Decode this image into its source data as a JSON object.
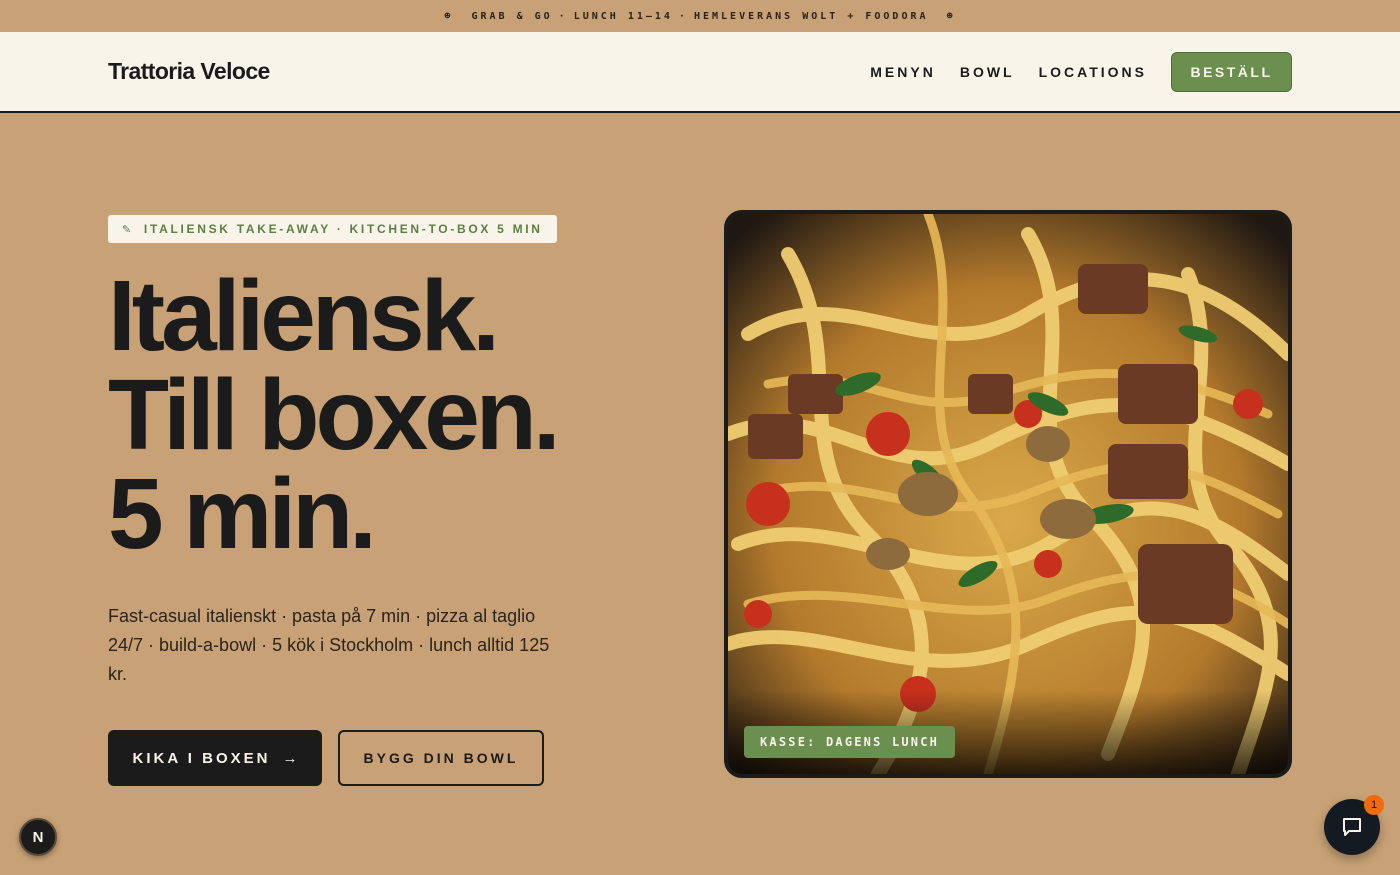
{
  "topbar": {
    "icon": "smiley-icon",
    "parts": [
      "GRAB & GO",
      "LUNCH 11–14",
      "HEMLEVERANS WOLT + FOODORA"
    ],
    "separator": "·"
  },
  "nav": {
    "brand": "Trattoria Veloce",
    "links": [
      "MENYN",
      "BOWL",
      "LOCATIONS"
    ],
    "order_label": "BESTÄLL"
  },
  "hero": {
    "tag": "ITALIENSK TAKE-AWAY · KITCHEN-TO-BOX 5 MIN",
    "tag_icon": "pin-icon",
    "headline": [
      "Italiensk.",
      "Till boxen.",
      "5 min."
    ],
    "subtitle": "Fast-casual italienskt · pasta på 7 min · pizza al taglio 24/7 · build-a-bowl · 5 kök i Stockholm · lunch alltid 125 kr.",
    "primary_cta": "KIKA I BOXEN",
    "primary_cta_arrow": "→",
    "secondary_cta": "BYGG DIN BOWL",
    "photo_label": "KASSE: DAGENS LUNCH"
  },
  "widgets": {
    "n_badge": "N",
    "chat_count": "1"
  },
  "colors": {
    "background": "#c8a176",
    "nav_background": "#f8f4ea",
    "accent_green": "#6a8f4e",
    "dark": "#1b1b1b",
    "notification": "#f06a0f"
  }
}
